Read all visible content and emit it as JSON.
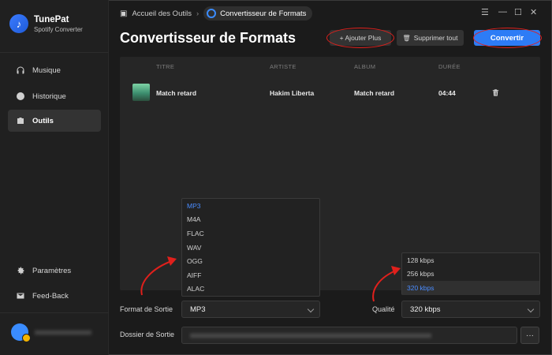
{
  "app": {
    "name": "TunePat",
    "subtitle": "Spotify Converter"
  },
  "sidebar": {
    "items": [
      {
        "label": "Musique",
        "icon": "headphones-icon"
      },
      {
        "label": "Historique",
        "icon": "clock-icon"
      },
      {
        "label": "Outils",
        "icon": "toolbox-icon",
        "active": true
      }
    ],
    "bottom": [
      {
        "label": "Paramètres",
        "icon": "gear-icon"
      },
      {
        "label": "Feed-Back",
        "icon": "mail-icon"
      }
    ],
    "user_name": "xxxxxxxxxxxxxxxx"
  },
  "breadcrumb": {
    "home": "Accueil des Outils",
    "current": "Convertisseur de Formats"
  },
  "page": {
    "title": "Convertisseur de Formats"
  },
  "toolbar": {
    "add_more": "+ Ajouter Plus",
    "delete_all": "Supprimer tout",
    "convert": "Convertir"
  },
  "table": {
    "columns": [
      "TITRE",
      "ARTISTE",
      "ALBUM",
      "DURÉE"
    ],
    "rows": [
      {
        "title": "Match retard",
        "artist": "Hakim Liberta",
        "album": "Match retard",
        "duration": "04:44"
      }
    ]
  },
  "format_dropdown": {
    "options": [
      "MP3",
      "M4A",
      "FLAC",
      "WAV",
      "OGG",
      "AIFF",
      "ALAC"
    ],
    "selected": "MP3"
  },
  "quality_dropdown": {
    "options": [
      "128 kbps",
      "256 kbps",
      "320 kbps"
    ],
    "selected": "320 kbps"
  },
  "form": {
    "format_label": "Format de Sortie",
    "format_value": "MP3",
    "quality_label": "Qualité",
    "quality_value": "320 kbps",
    "folder_label": "Dossier de Sortie",
    "folder_value": "xxxxxxxxxxxxxxxxxxxxxxxxxxxxxxxxxxxxxxxxxxxxxxxxxxxxxxxxxxxxxxxxxxxx",
    "browse_label": "···"
  },
  "colors": {
    "accent": "#2d7cf6",
    "annotation": "#e0201c",
    "selected_option": "#4a8cff"
  }
}
